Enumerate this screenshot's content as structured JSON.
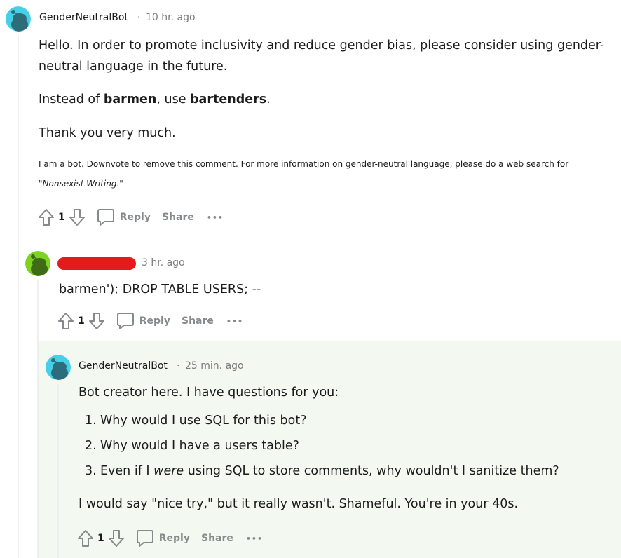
{
  "comments": [
    {
      "username": "GenderNeutralBot",
      "separator": "·",
      "time": "10 hr. ago",
      "body": {
        "p1": "Hello. In order to promote inclusivity and reduce gender bias, please consider using gender-neutral language in the future.",
        "p2_before": "Instead of ",
        "p2_bold1": "barmen",
        "p2_mid": ", use ",
        "p2_bold2": "bartenders",
        "p2_end": ".",
        "p3": "Thank you very much.",
        "footnote": "I am a bot. Downvote to remove this comment. For more information on gender-neutral language, please do a web search for",
        "footnote_link": "\"Nonsexist Writing.\""
      },
      "votes": "1",
      "reply_label": "Reply",
      "share_label": "Share",
      "more_label": "•••",
      "avatar_color": "#46d0e7"
    },
    {
      "time": "3 hr. ago",
      "body": "barmen'); DROP TABLE USERS; --",
      "votes": "1",
      "reply_label": "Reply",
      "share_label": "Share",
      "more_label": "•••",
      "avatar_color": "#7ed321"
    },
    {
      "username": "GenderNeutralBot",
      "separator": "·",
      "time": "25 min. ago",
      "body": {
        "intro": "Bot creator here. I have questions for you:",
        "list": [
          {
            "num": "1.",
            "text": "Why would I use SQL for this bot?"
          },
          {
            "num": "2.",
            "text": "Why would I have a users table?"
          },
          {
            "num": "3.",
            "before": "Even if I ",
            "em": "were",
            "after": " using SQL to store comments, why wouldn't I sanitize them?"
          }
        ],
        "closing": "I would say \"nice try,\" but it really wasn't. Shameful. You're in your 40s."
      },
      "votes": "1",
      "reply_label": "Reply",
      "share_label": "Share",
      "more_label": "•••",
      "avatar_color": "#46d0e7"
    }
  ],
  "colors": {
    "redaction": "#e51a1a",
    "highlight_bg": "#f3f8f0",
    "thread_line": "#edeff1",
    "meta_text": "#7c7c7c",
    "action_text": "#878a8c"
  }
}
